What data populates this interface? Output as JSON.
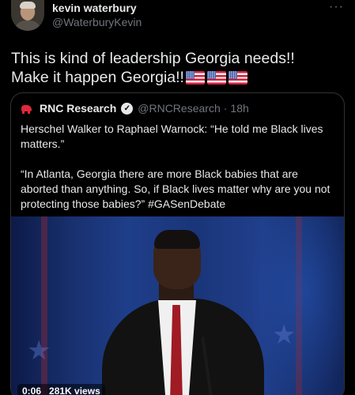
{
  "author": {
    "name": "kevin waterbury",
    "handle": "@WaterburyKevin",
    "avatar_icon": "profile-photo"
  },
  "more_icon": "···",
  "tweet": {
    "line1": "This is kind of leadership Georgia needs!!",
    "line2": "Make it happen Georgia!!",
    "flag_count": 3
  },
  "quoted": {
    "name": "RNC Research",
    "handle": "@RNCResearch",
    "separator": "·",
    "time": "18h",
    "verified_icon": "✓",
    "text": "Herschel Walker to Raphael Warnock: “He told me Black lives matters.”\n\n“In Atlanta, Georgia there are more Black babies that are aborted than anything. So, if Black lives matter why are you not protecting those babies?” #GASenDebate",
    "video": {
      "duration": "0:06",
      "views": "281K views"
    }
  },
  "colors": {
    "background": "#000000",
    "text": "#e7e9ea",
    "secondary": "#71767b",
    "border": "#2f3336",
    "rnc_red": "#e0283a"
  }
}
